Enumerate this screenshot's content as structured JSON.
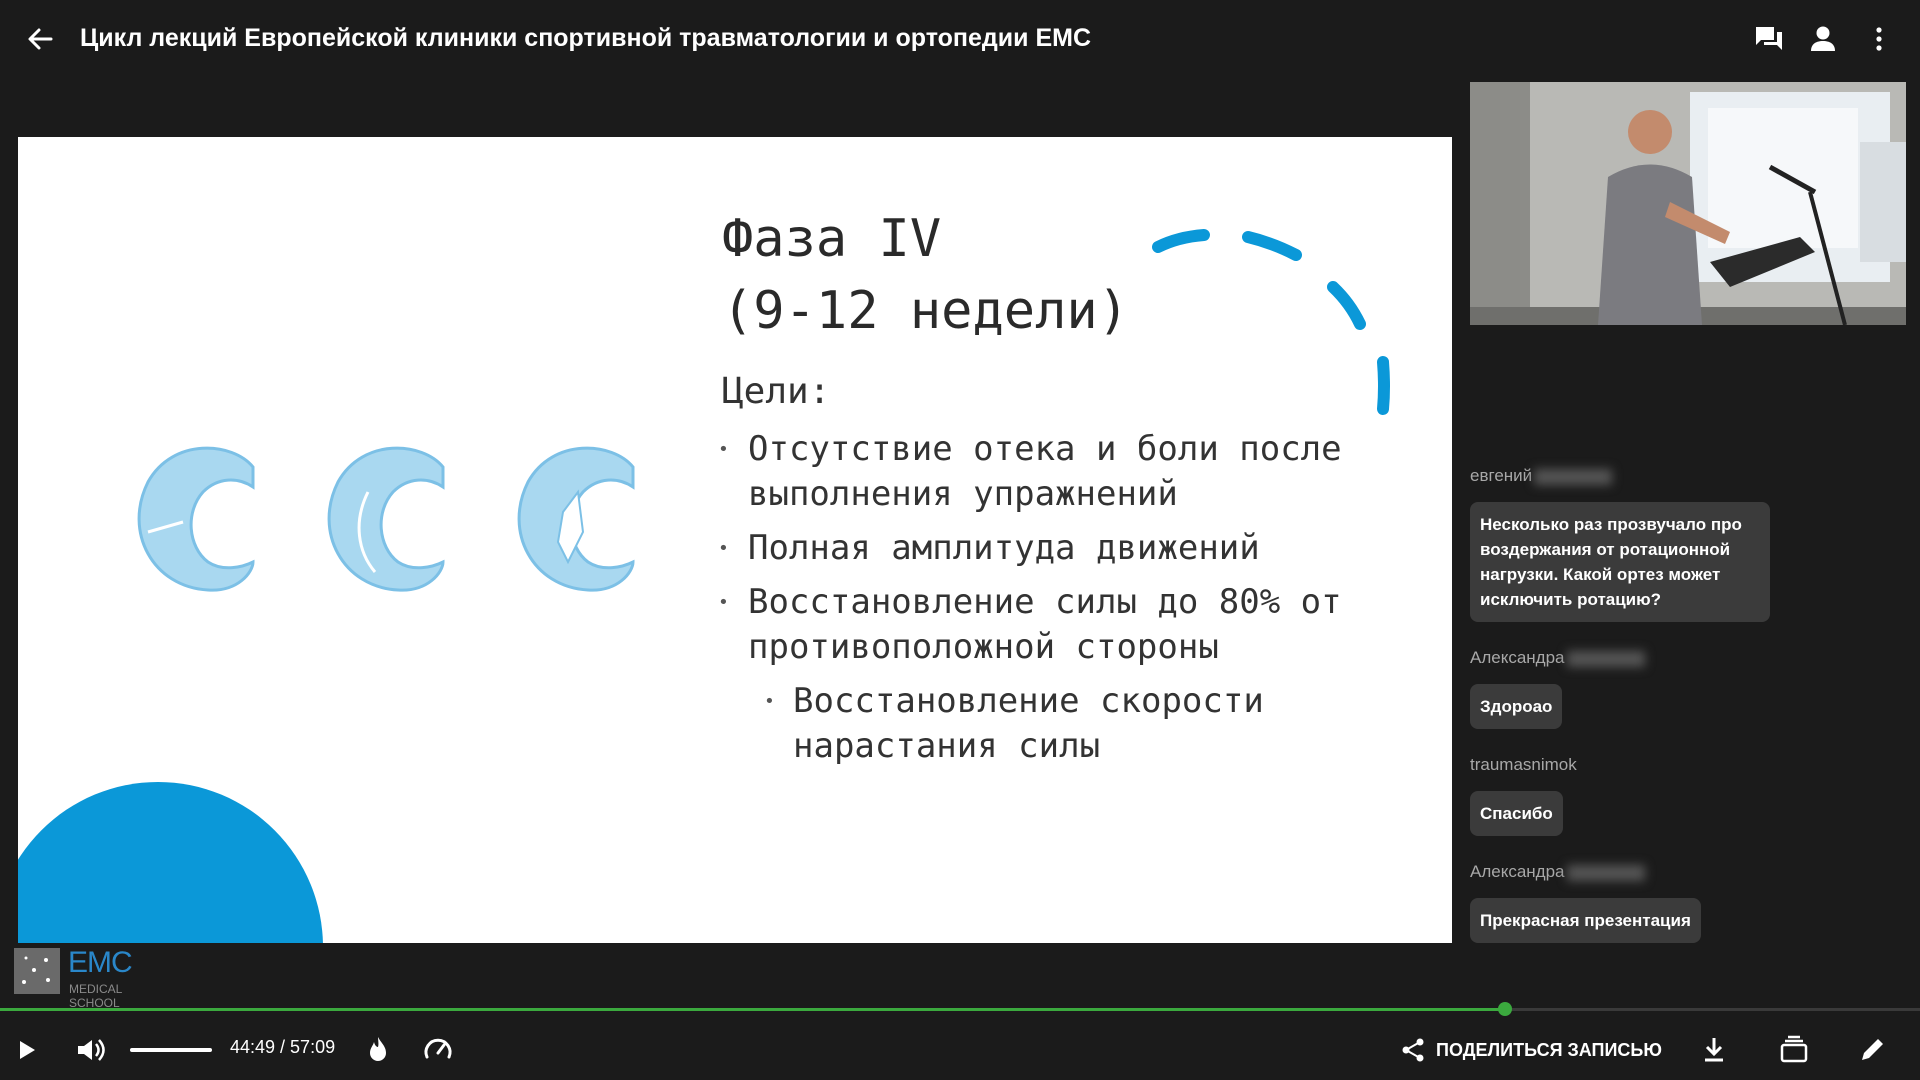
{
  "header": {
    "title": "Цикл лекций Европейской клиники спортивной травматологии и ортопедии ЕМС"
  },
  "slide": {
    "title": "Фаза IV\n(9-12 недели)",
    "goals_label": "Цели:",
    "bullets": [
      "Отсутствие отека и боли после выполнения упражнений",
      "Полная амплитуда движений",
      "Восстановление силы до 80% от противоположной стороны",
      "Восстановление скорости нарастания силы"
    ]
  },
  "chat": {
    "messages": [
      {
        "author": "евгений",
        "text": "Несколько раз прозвучало про воздержания от ротационной нагрузки. Какой ортез может исключить ротацию?"
      },
      {
        "author": "Александра",
        "text": "Здороао"
      },
      {
        "author": "traumasnimok",
        "text": "Спасибо"
      },
      {
        "author": "Александра",
        "text": "Прекрасная презентация"
      }
    ]
  },
  "logo": {
    "brand": "EMC",
    "subtitle": "MEDICAL SCHOOL"
  },
  "player": {
    "time": "44:49 / 57:09",
    "progress_fraction": 0.784,
    "share_label": "ПОДЕЛИТЬСЯ ЗАПИСЬЮ"
  },
  "colors": {
    "accent_progress": "#3ba93e",
    "slide_blue": "#0b98d8",
    "logo_blue": "#2a87c9"
  }
}
